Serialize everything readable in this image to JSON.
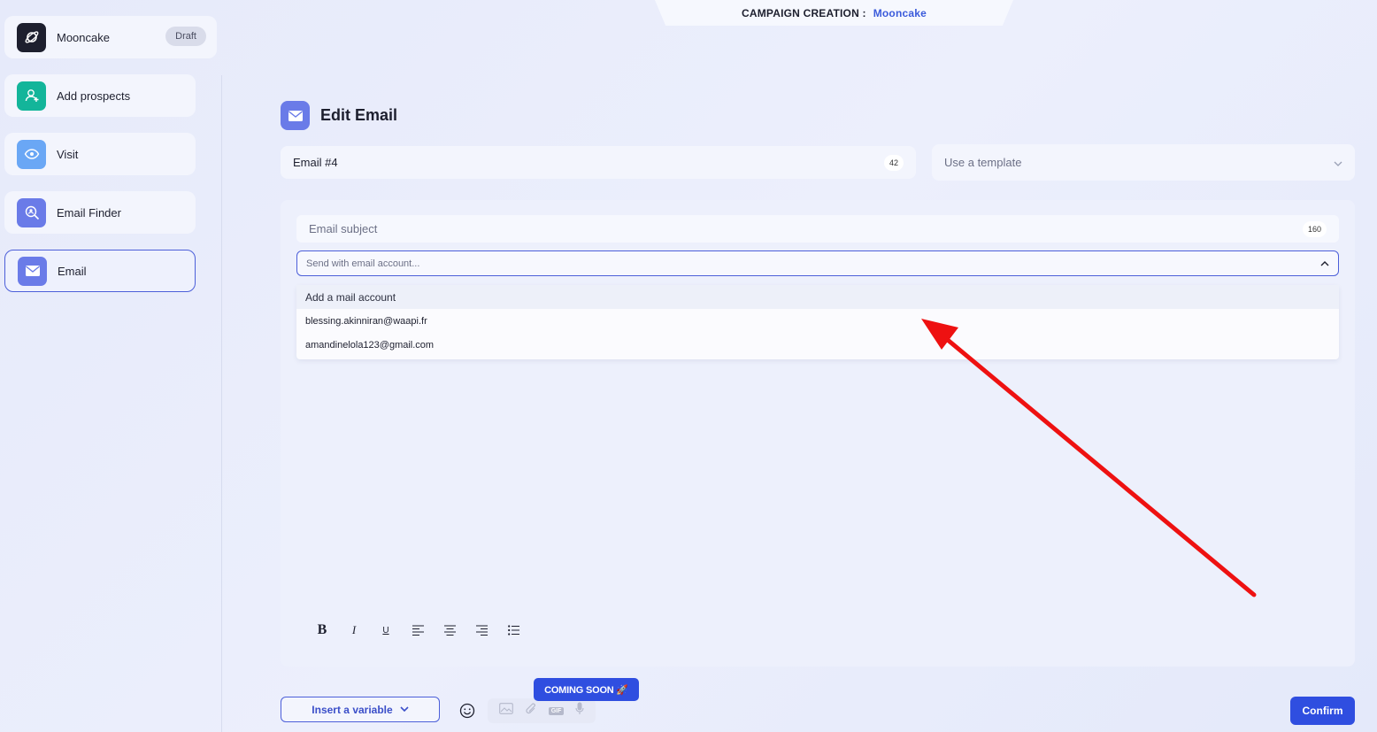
{
  "header": {
    "label": "CAMPAIGN CREATION :",
    "campaign_name": "Mooncake"
  },
  "sidebar": {
    "campaign": {
      "name": "Mooncake",
      "status": "Draft"
    },
    "steps": [
      {
        "label": "Add prospects",
        "icon": "user-plus-icon",
        "color": "#13b59a"
      },
      {
        "label": "Visit",
        "icon": "eye-icon",
        "color": "#6aa7f5"
      },
      {
        "label": "Email Finder",
        "icon": "search-user-icon",
        "color": "#6a7be8"
      },
      {
        "label": "Email",
        "icon": "envelope-icon",
        "color": "#6a7be8",
        "active": true
      }
    ]
  },
  "editor": {
    "title": "Edit Email",
    "email_name": "Email #4",
    "email_name_counter": "42",
    "template_placeholder": "Use a template",
    "subject_placeholder": "Email subject",
    "subject_counter": "160",
    "sender_placeholder": "Send with email account...",
    "sender_options": [
      "Add a mail account",
      "blessing.akinniran@waapi.fr",
      "amandinelola123@gmail.com"
    ],
    "toolbar": {
      "bold": "B",
      "italic": "I",
      "underline": "U"
    }
  },
  "footer": {
    "insert_variable": "Insert a variable",
    "coming_soon": "COMING SOON 🚀",
    "media_gif": "GIF",
    "confirm": "Confirm"
  },
  "colors": {
    "accent": "#2f4ee0",
    "arrow": "#ee1111"
  }
}
